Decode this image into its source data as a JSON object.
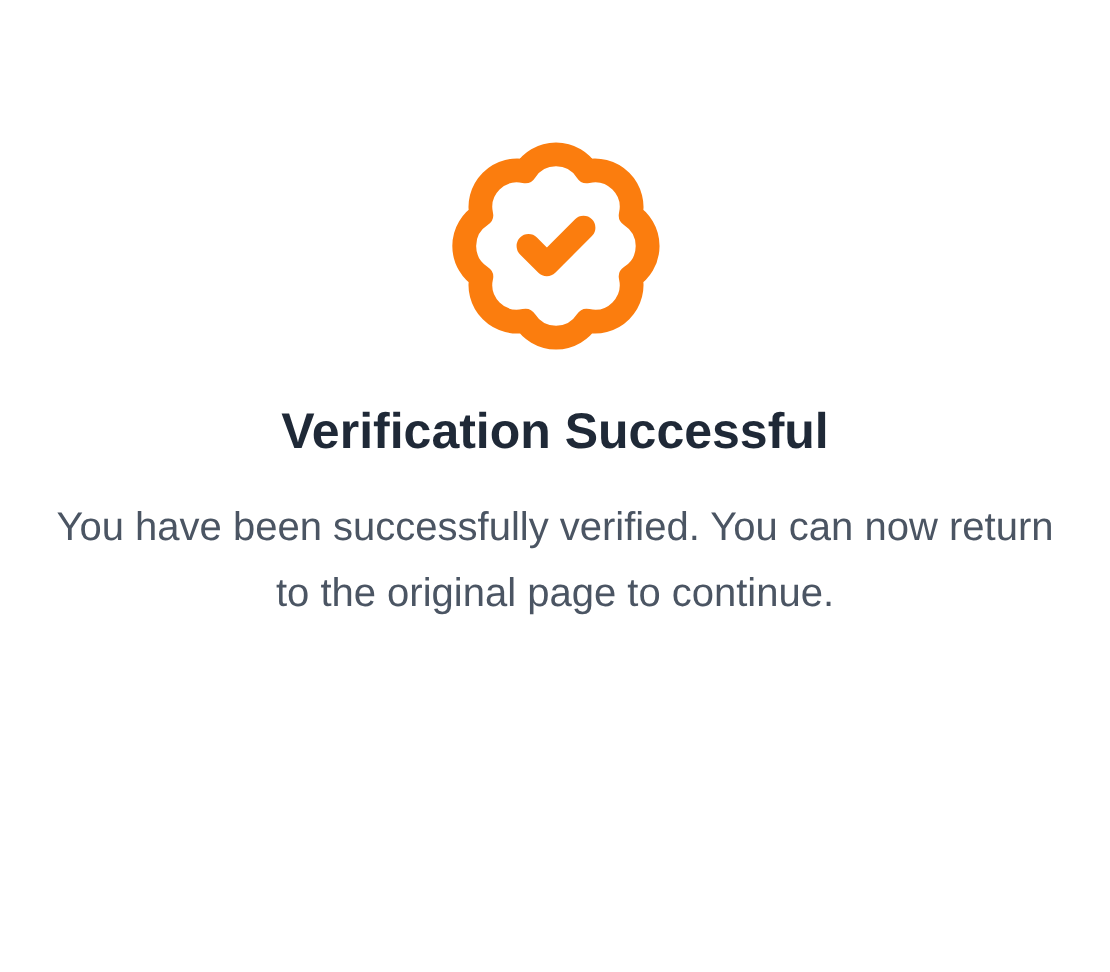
{
  "title": "Verification Successful",
  "message": "You have been successfully verified. You can now return to the original page to continue."
}
